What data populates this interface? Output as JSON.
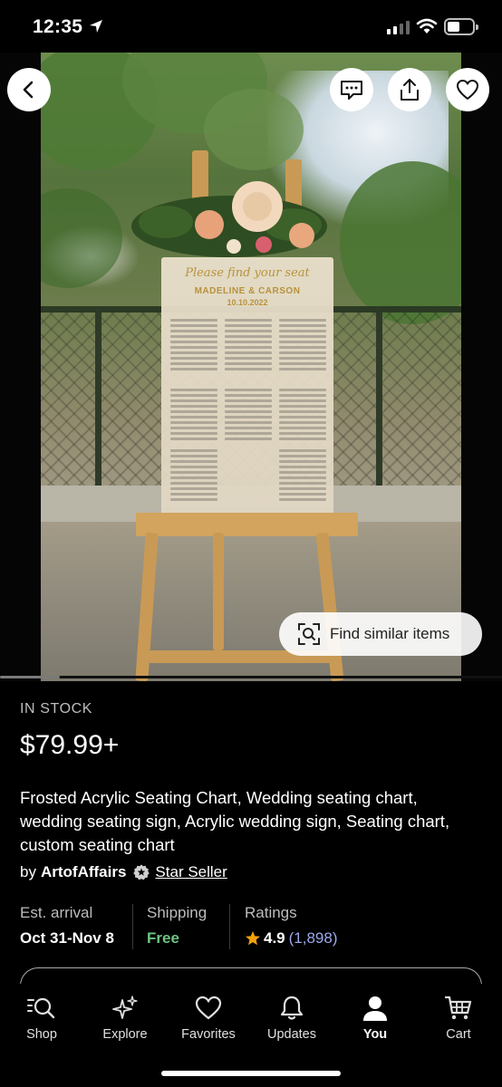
{
  "status_bar": {
    "time": "12:35"
  },
  "hero": {
    "board": {
      "title": "Please find your seat",
      "names": "MADELINE & CARSON",
      "date": "10.10.2022"
    },
    "similar_label": "Find similar items",
    "carousel_progress": 0.12
  },
  "listing": {
    "stock": "IN STOCK",
    "price": "$79.99+",
    "title": "Frosted Acrylic Seating Chart, Wedding seating chart, wedding seating sign, Acrylic wedding sign, Seating chart, custom seating chart",
    "seller_prefix": "by",
    "seller_name": "ArtofAffairs",
    "star_seller": "Star Seller"
  },
  "info": {
    "arrival_label": "Est. arrival",
    "arrival_value": "Oct 31-Nov 8",
    "shipping_label": "Shipping",
    "shipping_value": "Free",
    "ratings_label": "Ratings",
    "rating_value": "4.9",
    "rating_count": "(1,898)"
  },
  "tabs": [
    {
      "label": "Shop"
    },
    {
      "label": "Explore"
    },
    {
      "label": "Favorites"
    },
    {
      "label": "Updates"
    },
    {
      "label": "You"
    },
    {
      "label": "Cart"
    }
  ],
  "colors": {
    "accent_green": "#6ec482",
    "link_blue": "#9ea9ee",
    "star": "#f1a10d"
  }
}
